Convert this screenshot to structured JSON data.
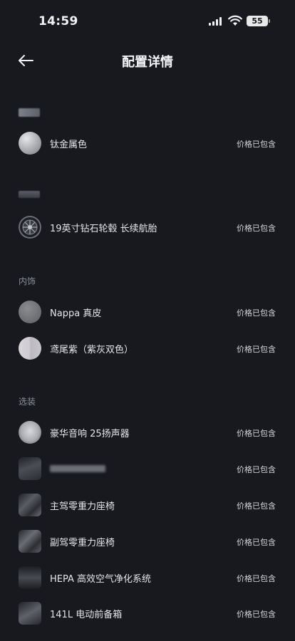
{
  "status": {
    "time": "14:59",
    "battery": "55"
  },
  "header": {
    "title": "配置详情"
  },
  "sections": {
    "exterior_label": "",
    "wheels_label": "",
    "interior_label": "内饰",
    "options_label": "选装"
  },
  "items": [
    {
      "label": "钛金属色",
      "price": "价格已包含",
      "icon": "color-swatch-titanium"
    },
    {
      "label": "19英寸钻石轮毂 长续航胎",
      "price": "价格已包含",
      "icon": "wheel-icon"
    },
    {
      "label": "Nappa 真皮",
      "price": "价格已包含",
      "icon": "leather-swatch"
    },
    {
      "label": "鸢尾紫（紫灰双色）",
      "price": "价格已包含",
      "icon": "interior-color-swatch"
    },
    {
      "label": "豪华音响 25扬声器",
      "price": "价格已包含",
      "icon": "speaker-icon"
    },
    {
      "label": "",
      "price": "价格已包含",
      "icon": "accessory-icon"
    },
    {
      "label": "主驾零重力座椅",
      "price": "价格已包含",
      "icon": "seat-icon"
    },
    {
      "label": "副驾零重力座椅",
      "price": "价格已包含",
      "icon": "seat-icon"
    },
    {
      "label": "HEPA 高效空气净化系统",
      "price": "价格已包含",
      "icon": "air-filter-icon"
    },
    {
      "label": "141L 电动前备箱",
      "price": "价格已包含",
      "icon": "frunk-icon"
    }
  ],
  "colors": {
    "background": "#17191f",
    "text_primary": "#e4e5e8",
    "text_secondary": "#8d9098"
  }
}
